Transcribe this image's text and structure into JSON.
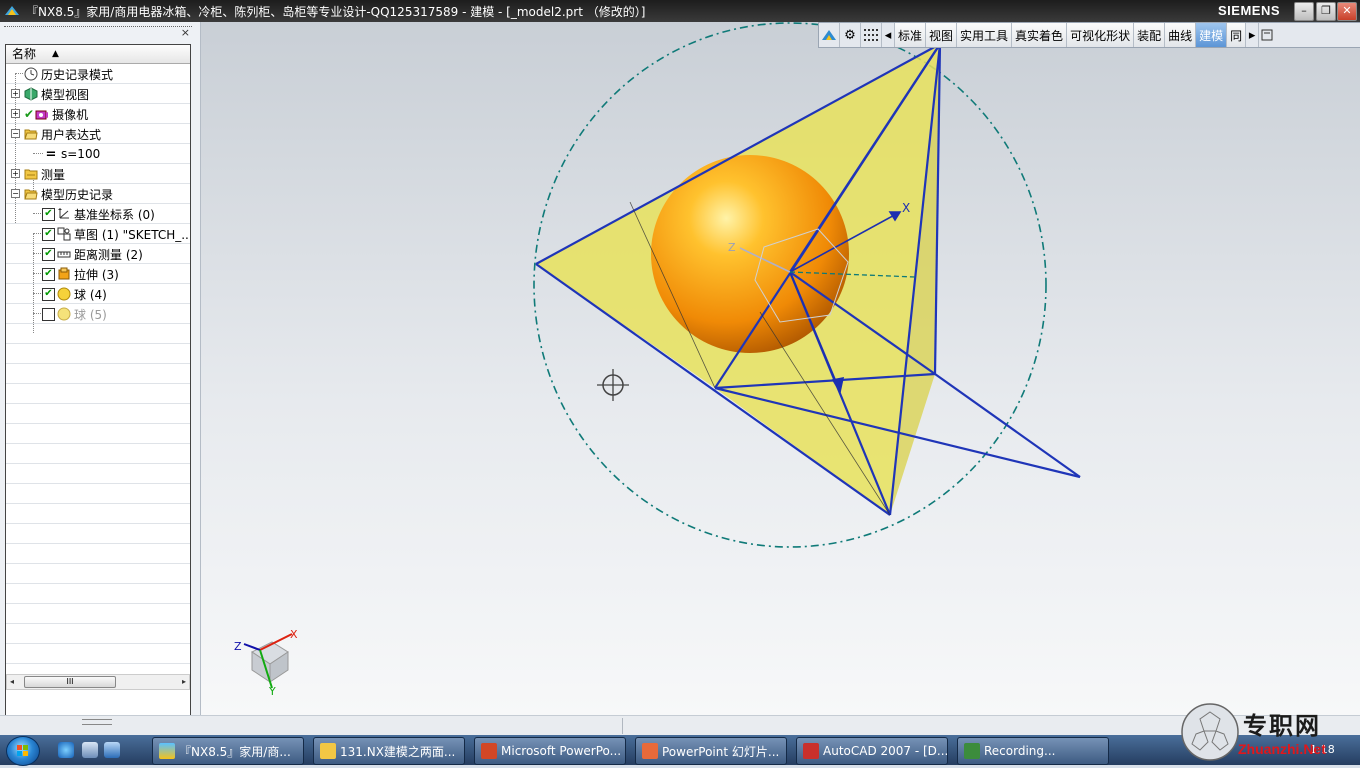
{
  "window": {
    "title": "『NX8.5』家用/商用电器冰箱、冷柜、陈列柜、岛柜等专业设计-QQ125317589 - 建模 - [_model2.prt （修改的）]",
    "brand": "SIEMENS",
    "minimize": "–",
    "restore": "❐",
    "close": "✕"
  },
  "navigator": {
    "close": "×",
    "column_header": "名称",
    "sort_arrow": "▲",
    "rows": [
      {
        "label": "历史记录模式",
        "icon": "clock-icon"
      },
      {
        "label": "模型视图",
        "icon": "model-views-icon"
      },
      {
        "label": "摄像机",
        "icon": "camera-icon"
      },
      {
        "label": "用户表达式",
        "icon": "folder-open-icon"
      },
      {
        "label": "s=100",
        "icon": "equals-icon"
      },
      {
        "label": "测量",
        "icon": "folder-icon"
      },
      {
        "label": "模型历史记录",
        "icon": "folder-open-icon"
      },
      {
        "label": "基准坐标系 (0)",
        "icon": "datum-csys-icon",
        "checked": true
      },
      {
        "label": "草图 (1) \"SKETCH_...",
        "icon": "sketch-icon",
        "checked": true
      },
      {
        "label": "距离测量 (2)",
        "icon": "measure-distance-icon",
        "checked": true
      },
      {
        "label": "拉伸 (3)",
        "icon": "extrude-icon",
        "checked": true
      },
      {
        "label": "球 (4)",
        "icon": "sphere-icon",
        "checked": true
      },
      {
        "label": "球 (5)",
        "icon": "sphere-icon",
        "checked": false
      }
    ],
    "hscroll_thumb": "III",
    "hscroll_left": "◂",
    "hscroll_right": "▸"
  },
  "ribbon": {
    "icons": [
      "nx-logo-icon",
      "gear-icon",
      "grid-icon"
    ],
    "scroll_left": "◂",
    "scroll_right": "▸",
    "tabs": [
      "标准",
      "视图",
      "实用工具",
      "真实着色",
      "可视化形状",
      "装配",
      "曲线",
      "建模",
      "同"
    ],
    "active_tab": "建模"
  },
  "viewport": {
    "axis_labels": {
      "x": "X",
      "z": "Z"
    },
    "triad_labels": {
      "x": "X",
      "y": "Y",
      "z": "Z"
    },
    "colors": {
      "face_fill": "#e8e25c",
      "edge": "#1f35b8",
      "sphere": "#f39a0a",
      "bounding_circle": "#0f7a78",
      "csys": "#1c2fb0"
    }
  },
  "taskbar": {
    "tasks": [
      {
        "label": "『NX8.5』家用/商...",
        "icon": "nx-icon"
      },
      {
        "label": "131.NX建模之两面...",
        "icon": "folder-icon"
      },
      {
        "label": "Microsoft PowerPo...",
        "icon": "powerpoint-icon"
      },
      {
        "label": "PowerPoint 幻灯片...",
        "icon": "powerpoint-slide-icon"
      },
      {
        "label": "AutoCAD 2007 - [D...",
        "icon": "autocad-icon"
      },
      {
        "label": "Recording...",
        "icon": "recording-icon"
      }
    ],
    "clock": "1:18"
  },
  "watermark": {
    "text": "专职网",
    "url": "Zhuanzhi.Net"
  }
}
